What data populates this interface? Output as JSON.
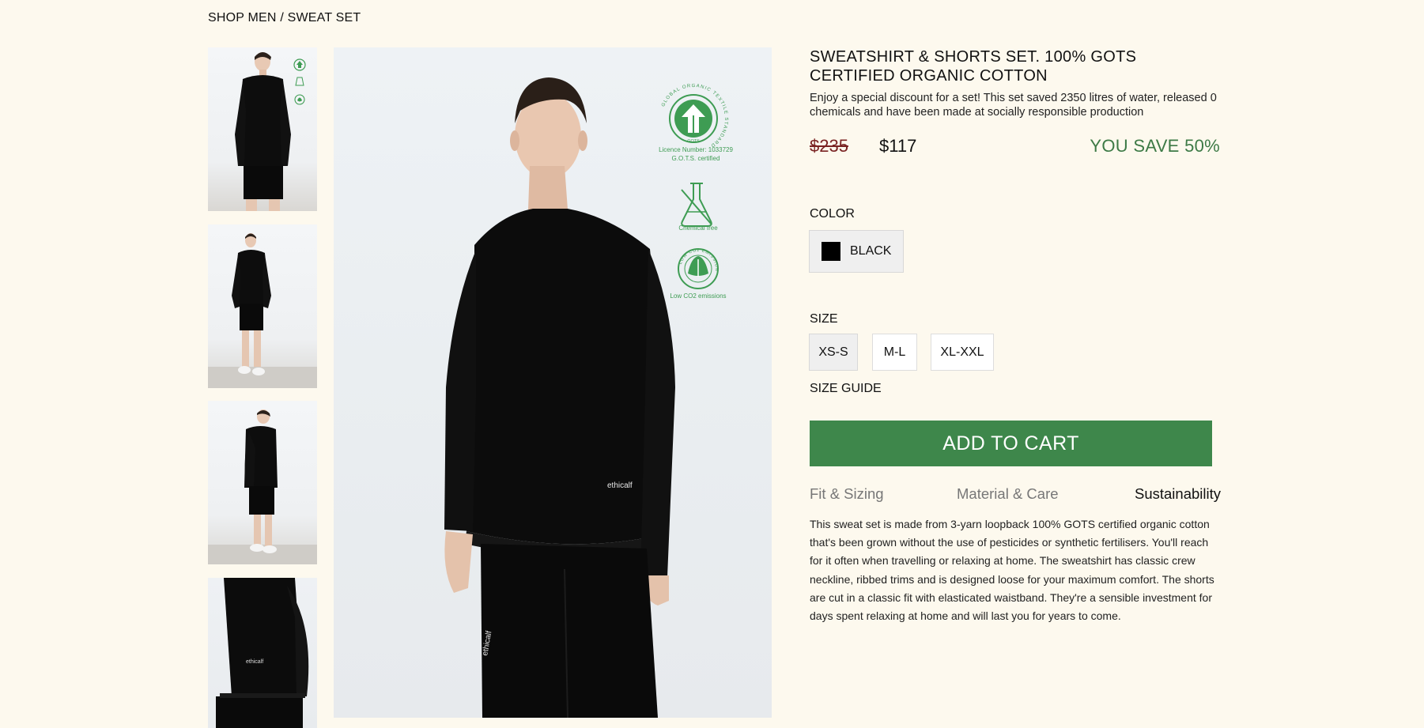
{
  "breadcrumb": {
    "parent": "SHOP MEN",
    "separator": "/",
    "current": "SWEAT SET"
  },
  "product": {
    "title": "SWEATSHIRT & SHORTS SET. 100% GOTS CERTIFIED ORGANIC COTTON",
    "subtitle": "Enjoy a special discount for a set! This set saved 2350 litres of water, released 0 chemicals and have been made at socially responsible production",
    "price_old": "$235",
    "price_new": "$117",
    "savings": "YOU SAVE 50%"
  },
  "badges": {
    "gots_ring": "GLOBAL ORGANIC TEXTILE STANDARD",
    "gots_mark": "GOTS",
    "gots_licence": "Licence Number: 1033729",
    "gots_certified": "G.O.T.S. certified",
    "chemical_free": "Chemical free",
    "low_co2_ring": "LOW CO2 EMISSION",
    "low_co2": "Low CO2 emissions"
  },
  "garment_logo": "ethicalf",
  "color": {
    "label": "COLOR",
    "selected": "BLACK",
    "swatch": "#000000"
  },
  "size": {
    "label": "SIZE",
    "options": [
      "XS-S",
      "M-L",
      "XL-XXL"
    ],
    "selected": "XS-S",
    "guide": "SIZE GUIDE"
  },
  "cart_button": "ADD TO CART",
  "tabs": [
    "Fit & Sizing",
    "Material & Care",
    "Sustainability"
  ],
  "active_tab": "Sustainability",
  "description": "This sweat set is made from 3-yarn loopback 100% GOTS certified organic cotton that's been grown without the use of pesticides or synthetic fertilisers. You'll reach for it often when travelling or relaxing at home. The sweatshirt has classic crew neckline, ribbed trims and is designed loose for your maximum comfort. The shorts are cut in a classic fit with elasticated waistband. They're a sensible investment for days spent relaxing at home and will last you for years to come.",
  "colors": {
    "background": "#fdf9ee",
    "accent_green": "#3e874b",
    "savings_green": "#3d7a46",
    "old_price": "#7a2323",
    "badge_green": "#3e9c53"
  }
}
